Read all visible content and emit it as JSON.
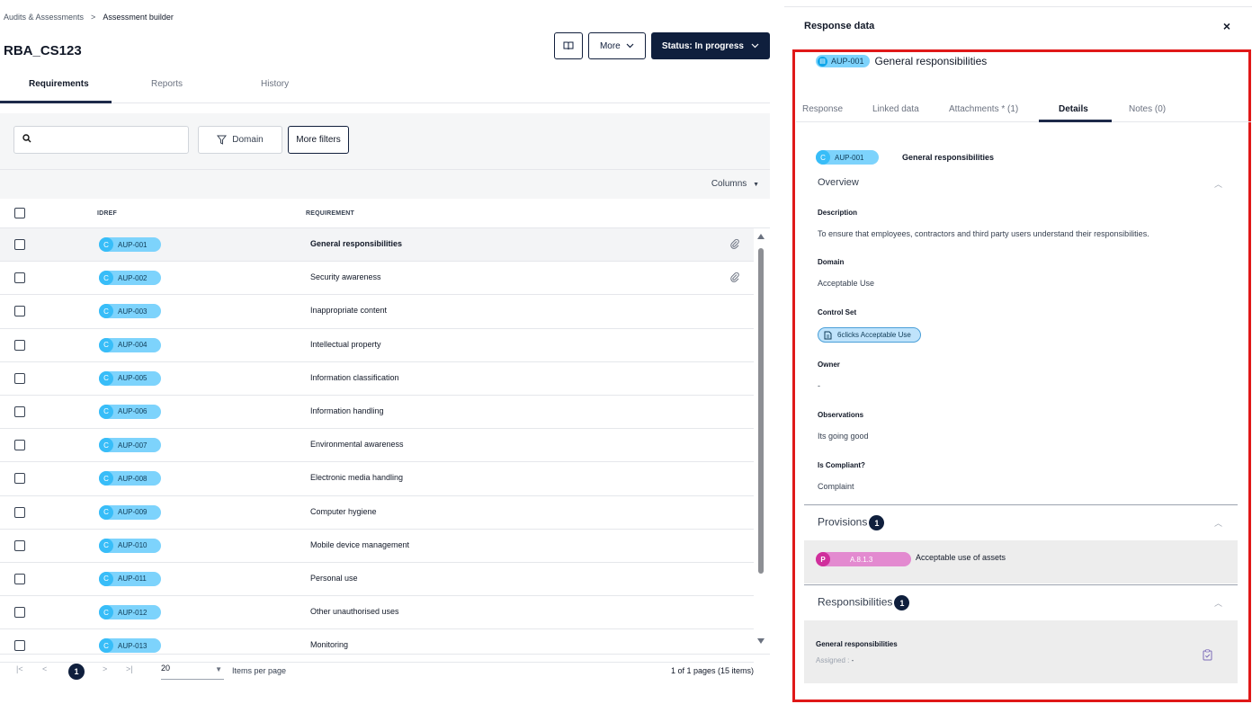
{
  "breadcrumb": {
    "parent": "Audits & Assessments",
    "separator": ">",
    "current": "Assessment builder"
  },
  "page_title": "RBA_CS123",
  "header_buttons": {
    "more": "More",
    "status": "Status: In progress"
  },
  "tabs": [
    "Requirements",
    "Reports",
    "History"
  ],
  "filters": {
    "search_placeholder": "",
    "domain": "Domain",
    "more_filters": "More filters"
  },
  "columns_label": "Columns",
  "table": {
    "headers": [
      "IDREF",
      "REQUIREMENT"
    ],
    "rows": [
      {
        "prefix": "C",
        "id": "AUP-001",
        "requirement": "General responsibilities",
        "attachment": true
      },
      {
        "prefix": "C",
        "id": "AUP-002",
        "requirement": "Security awareness",
        "attachment": true
      },
      {
        "prefix": "C",
        "id": "AUP-003",
        "requirement": "Inappropriate content",
        "attachment": false
      },
      {
        "prefix": "C",
        "id": "AUP-004",
        "requirement": "Intellectual property",
        "attachment": false
      },
      {
        "prefix": "C",
        "id": "AUP-005",
        "requirement": "Information classification",
        "attachment": false
      },
      {
        "prefix": "C",
        "id": "AUP-006",
        "requirement": "Information handling",
        "attachment": false
      },
      {
        "prefix": "C",
        "id": "AUP-007",
        "requirement": "Environmental awareness",
        "attachment": false
      },
      {
        "prefix": "C",
        "id": "AUP-008",
        "requirement": "Electronic media handling",
        "attachment": false
      },
      {
        "prefix": "C",
        "id": "AUP-009",
        "requirement": "Computer hygiene",
        "attachment": false
      },
      {
        "prefix": "C",
        "id": "AUP-010",
        "requirement": "Mobile device management",
        "attachment": false
      },
      {
        "prefix": "C",
        "id": "AUP-011",
        "requirement": "Personal use",
        "attachment": false
      },
      {
        "prefix": "C",
        "id": "AUP-012",
        "requirement": "Other unauthorised uses",
        "attachment": false
      },
      {
        "prefix": "C",
        "id": "AUP-013",
        "requirement": "Monitoring",
        "attachment": false
      }
    ]
  },
  "pager": {
    "first": "|<",
    "prev": "<",
    "current": "1",
    "next": ">",
    "last": ">|",
    "per_page": "20",
    "per_page_label": "Items per page",
    "info": "1 of 1 pages (15 items)"
  },
  "panel": {
    "title": "Response data",
    "close": "×",
    "id": "AUP-001",
    "name": "General responsibilities",
    "tabs": [
      "Response",
      "Linked data",
      "Attachments * (1)",
      "Details",
      "Notes (0)"
    ],
    "details": {
      "prefix": "C",
      "overview": "Overview",
      "fields": [
        {
          "label": "Description",
          "value": "To ensure that employees, contractors and third party users understand their responsibilities."
        },
        {
          "label": "Domain",
          "value": "Acceptable Use"
        },
        {
          "label": "Control Set",
          "value": "6clicks Acceptable Use"
        },
        {
          "label": "Owner",
          "value": "-"
        },
        {
          "label": "Observations",
          "value": "Its going good"
        },
        {
          "label": "Is Compliant?",
          "value": "Complaint"
        }
      ],
      "provisions": {
        "title": "Provisions",
        "count": "1",
        "prefix": "P",
        "id": "A.8.1.3",
        "name": "Acceptable use of assets"
      },
      "responsibilities": {
        "title": "Responsibilities",
        "count": "1",
        "name": "General responsibilities",
        "assigned_label": "Assigned :",
        "assigned_value": "-"
      }
    }
  },
  "colors": {
    "navy": "#0f1f3d",
    "chip": "#7dd3fc",
    "highlight": "#e01818",
    "provision": "#d02f9c"
  }
}
